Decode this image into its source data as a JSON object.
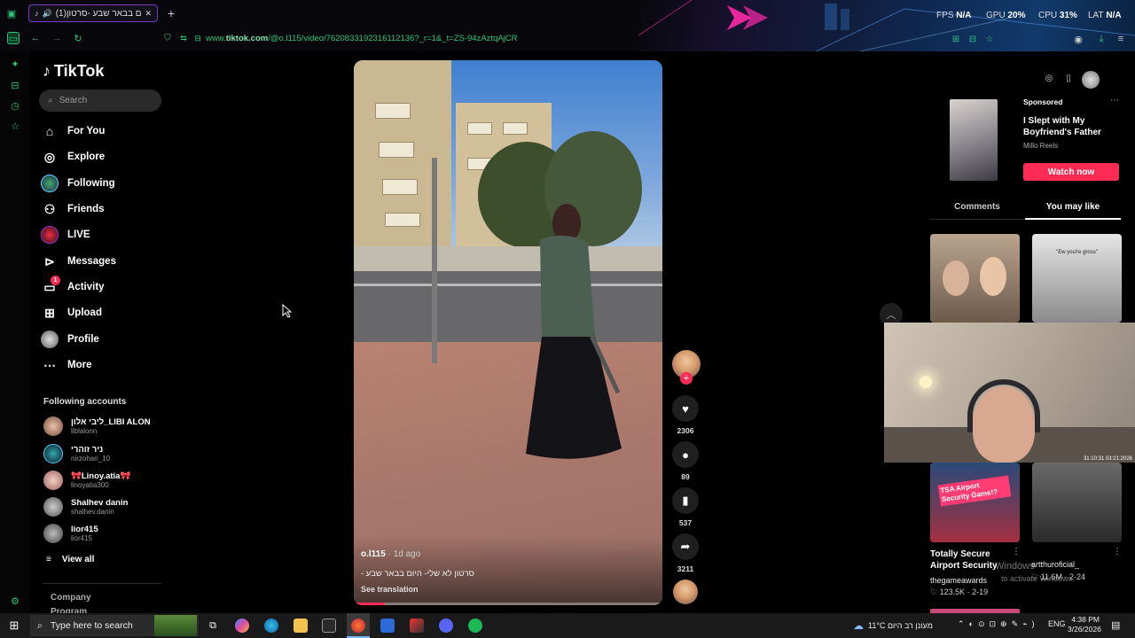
{
  "browser": {
    "tab_title": "(1)היום בבאר שבע -סרטון",
    "url_prefix": "www.",
    "url_domain": "tiktok.com",
    "url_path": "/@o.l115/video/7620833192316112136?_r=1&_t=ZS-94zAztqAjCR"
  },
  "perf": {
    "fps_label": "FPS",
    "fps_value": "N/A",
    "gpu_label": "GPU",
    "gpu_value": "20%",
    "cpu_label": "CPU",
    "cpu_value": "31%",
    "lat_label": "LAT",
    "lat_value": "N/A"
  },
  "sidebar": {
    "logo": "TikTok",
    "search_placeholder": "Search",
    "nav": [
      {
        "label": "For You",
        "icon": "home-icon"
      },
      {
        "label": "Explore",
        "icon": "compass-icon"
      },
      {
        "label": "Following",
        "icon": "following-avatar-icon"
      },
      {
        "label": "Friends",
        "icon": "friends-icon"
      },
      {
        "label": "LIVE",
        "icon": "live-icon"
      },
      {
        "label": "Messages",
        "icon": "messages-icon"
      },
      {
        "label": "Activity",
        "icon": "activity-icon",
        "badge": "1"
      },
      {
        "label": "Upload",
        "icon": "upload-icon"
      },
      {
        "label": "Profile",
        "icon": "profile-avatar-icon"
      },
      {
        "label": "More",
        "icon": "more-icon"
      }
    ],
    "following_header": "Following accounts",
    "accounts": [
      {
        "name": "ליבי אלון_LIBI ALON",
        "handle": "liblalonn"
      },
      {
        "name": "ניר זוהרי",
        "handle": "nirzohari_10"
      },
      {
        "name": "🎀Linoy.atia🎀",
        "handle": "linoyatia300"
      },
      {
        "name": "Shalhev danin",
        "handle": "shalhev.danin"
      },
      {
        "name": "lior415",
        "handle": "lior415"
      }
    ],
    "view_all": "View all",
    "company": "Company",
    "program_partial": "Program"
  },
  "video": {
    "author": "o.l115",
    "age": " · 1d ago",
    "description": "סרטון לא שלי- היום בבאר שבע -",
    "see_translation": "See translation",
    "progress": 0.1
  },
  "actions": {
    "likes": "2306",
    "comments": "89",
    "saves": "537",
    "shares": "3211"
  },
  "right": {
    "sponsored": "Sponsored",
    "ad_title": "I Slept with My Boyfriend's Father",
    "ad_source": "Millo Reels",
    "watch_now": "Watch now",
    "tab_comments": "Comments",
    "tab_you_may_like": "You may like",
    "thumb2_caption": "\"Ew you're gross\"",
    "thumb3_caption": "TSA Airport Security Game!?",
    "item1_title": "Totally Secure Airport Security",
    "item1_author": "thegameawards",
    "item1_likes": "123.5K",
    "item1_date": "2-19",
    "item2_author": "artthuroficial_",
    "item2_likes": "11.6M",
    "item2_date": "2-24",
    "watermark": "Windows",
    "watermark2": "to activate Windows.",
    "cam_timestamp": "31:10:31 03:21:2026"
  },
  "taskbar": {
    "search": "Type here to search",
    "weather": "11°C מעונן רב היום",
    "lang": "ENG",
    "time": "4:38 PM",
    "date": "3/26/2026"
  },
  "colors": {
    "accent": "#fe2c55",
    "url_green": "#2ec47a",
    "tab_border": "#7b39c9"
  }
}
